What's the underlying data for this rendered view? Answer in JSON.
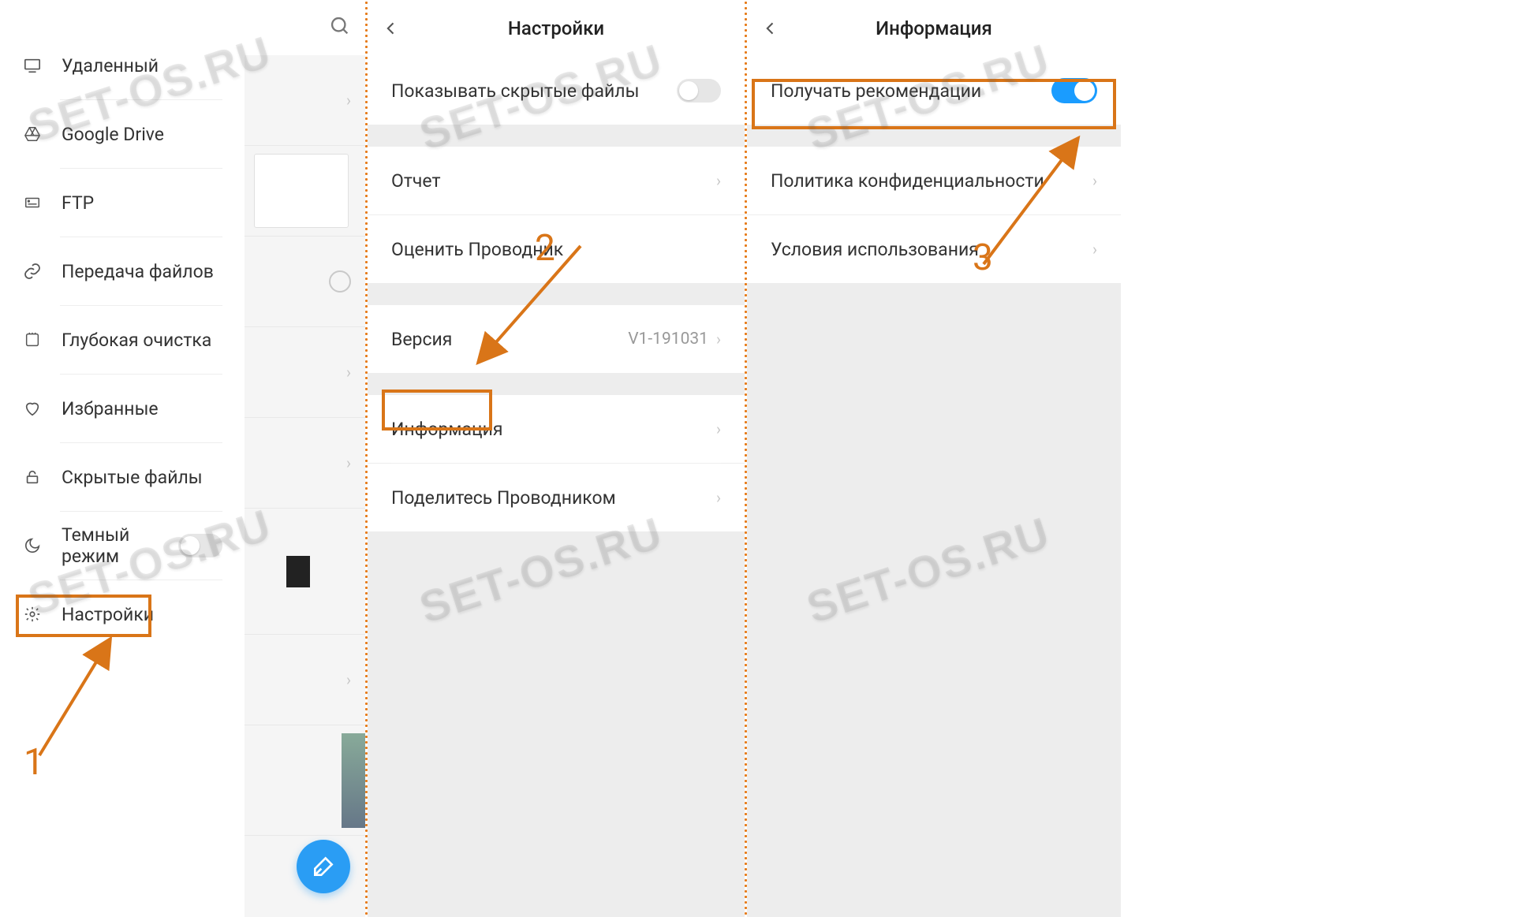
{
  "panel1": {
    "menu": [
      {
        "icon": "monitor-icon",
        "label": "Удаленный",
        "chevron": false
      },
      {
        "icon": "gdrive-icon",
        "label": "Google Drive",
        "chevron": true
      },
      {
        "icon": "ftp-icon",
        "label": "FTP",
        "chevron": false
      },
      {
        "icon": "link-icon",
        "label": "Передача файлов",
        "chevron": false
      },
      {
        "icon": "clean-icon",
        "label": "Глубокая очистка",
        "chevron": false
      },
      {
        "icon": "heart-icon",
        "label": "Избранные",
        "chevron": false
      },
      {
        "icon": "lock-icon",
        "label": "Скрытые файлы",
        "chevron": false
      },
      {
        "icon": "moon-icon",
        "label": "Темный режим",
        "chevron": false,
        "toggle": "off"
      },
      {
        "icon": "gear-icon",
        "label": "Настройки",
        "chevron": false
      }
    ]
  },
  "panel2": {
    "title": "Настройки",
    "rows": {
      "hidden_files": "Показывать скрытые файлы",
      "report": "Отчет",
      "rate": "Оценить Проводник",
      "version_label": "Версия",
      "version_value": "V1-191031",
      "info": "Информация",
      "share": "Поделитесь Проводником"
    }
  },
  "panel3": {
    "title": "Информация",
    "rows": {
      "recommendations": "Получать рекомендации",
      "privacy": "Политика конфиденциальности",
      "terms": "Условия использования"
    }
  },
  "steps": {
    "s1": "1",
    "s2": "2",
    "s3": "3"
  },
  "watermark": "SET-OS.RU"
}
